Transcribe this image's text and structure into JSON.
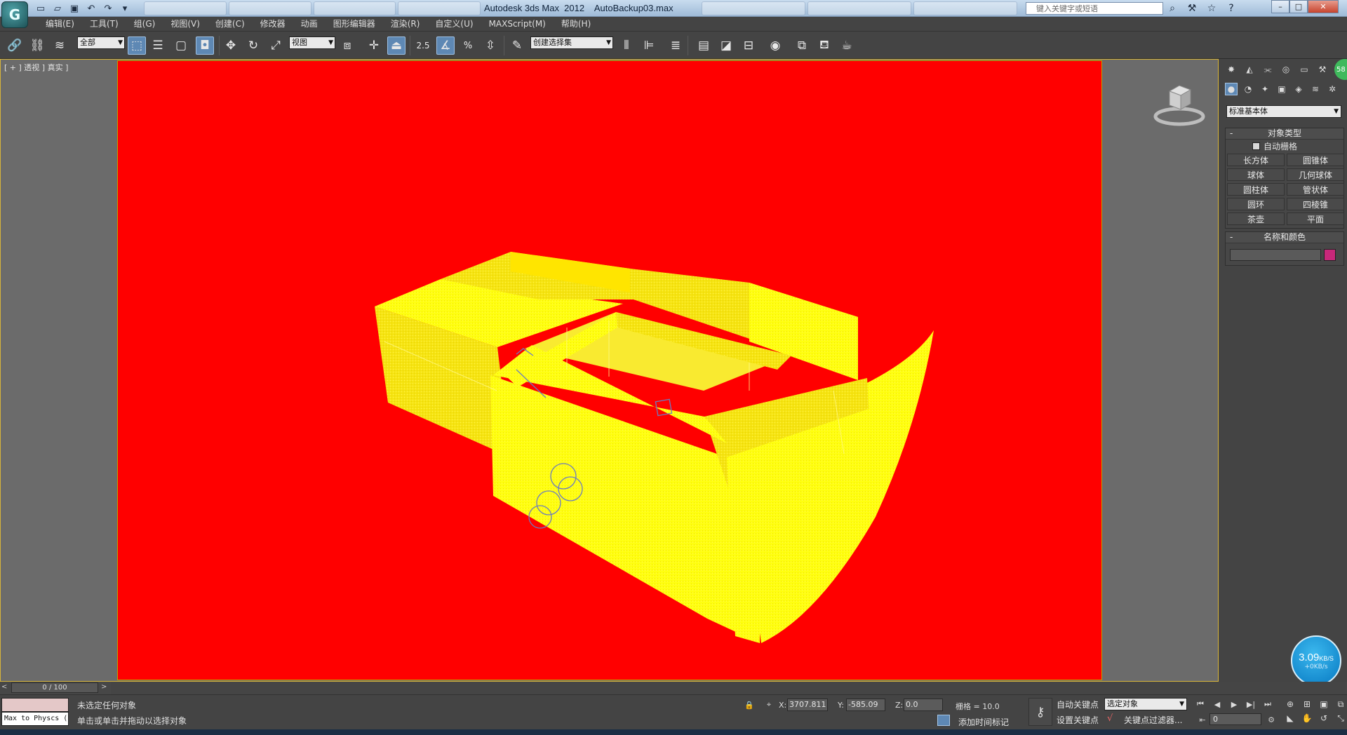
{
  "app": {
    "logo_letter": "G",
    "title": "Autodesk 3ds Max  2012",
    "filename": "AutoBackup03.max",
    "search_placeholder": "键入关键字或短语"
  },
  "titlebar": {
    "quick_access_icons": [
      "new-file-icon",
      "open-file-icon",
      "save-icon",
      "undo-icon",
      "redo-icon",
      "dropdown-icon"
    ],
    "tools_icons": [
      "binoculars-icon",
      "tools-icon",
      "favorites-star-icon",
      "help-icon"
    ],
    "window_controls": [
      "minimize",
      "maximize",
      "close"
    ]
  },
  "menu": {
    "items": [
      "编辑(E)",
      "工具(T)",
      "组(G)",
      "视图(V)",
      "创建(C)",
      "修改器",
      "动画",
      "图形编辑器",
      "渲染(R)",
      "自定义(U)",
      "MAXScript(M)",
      "帮助(H)"
    ]
  },
  "toolbar": {
    "selection_filter": "全部",
    "reference_coord": "视图",
    "named_selection": "创建选择集",
    "snap_label": "2.5",
    "angle_snap_label": "%"
  },
  "viewport": {
    "label": "[ + ] 透视 ] 真实 ]",
    "background_color": "#ff0000",
    "model_color": "#ffff00"
  },
  "command_panel": {
    "top_tabs": [
      "create-tab",
      "modify-tab",
      "hierarchy-tab",
      "motion-tab",
      "display-tab",
      "utilities-tab"
    ],
    "sub_tabs": [
      "geometry-tab",
      "shapes-tab",
      "lights-tab",
      "cameras-tab",
      "helpers-tab",
      "spacewarps-tab",
      "systems-tab"
    ],
    "category": "标准基本体",
    "object_type": {
      "title": "对象类型",
      "autogrid_label": "自动栅格",
      "buttons": [
        "长方体",
        "圆锥体",
        "球体",
        "几何球体",
        "圆柱体",
        "管状体",
        "圆环",
        "四棱锥",
        "茶壶",
        "平面"
      ]
    },
    "name_color": {
      "title": "名称和颜色",
      "name_value": "",
      "swatch_color": "#c8287a"
    },
    "green_badge": "58"
  },
  "network": {
    "speed": "3.09",
    "unit": "KB/S",
    "sub": "+0KB/s"
  },
  "time_slider": {
    "position_label": "0 / 100",
    "prev": "<",
    "next": ">"
  },
  "status": {
    "listener_text": "Max to Physcs (",
    "line1": "未选定任何对象",
    "line2": "单击或单击并拖动以选择对象",
    "x_label": "X:",
    "x_value": "3707.811",
    "y_label": "Y:",
    "y_value": "-585.09",
    "z_label": "Z:",
    "z_value": "0.0",
    "grid": "栅格 = 10.0",
    "auto_key": "自动关键点",
    "set_key": "设置关键点",
    "selected_mode": "选定对象",
    "key_filters": "关键点过滤器...",
    "add_time_tag": "添加时间标记",
    "current_frame": "0"
  }
}
